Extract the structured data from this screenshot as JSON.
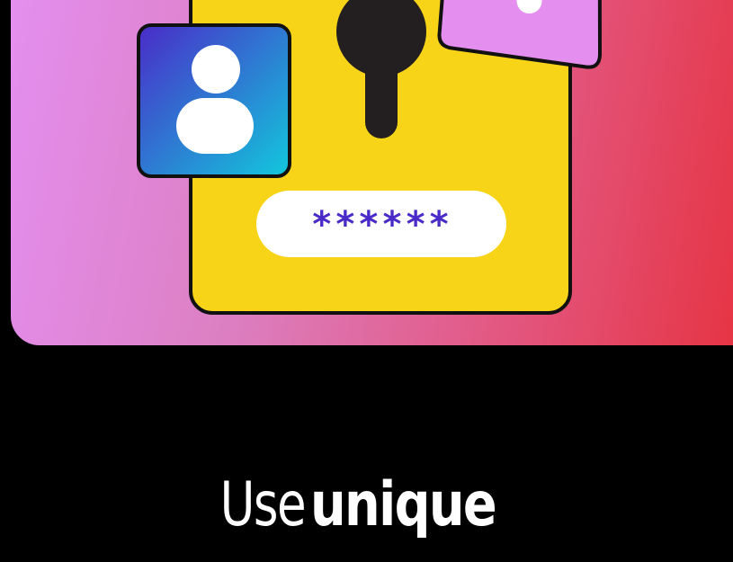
{
  "illustration": {
    "password_mask": "******",
    "icons": [
      "lock-icon",
      "keyhole-icon",
      "user-avatar-icon",
      "tag-icon"
    ],
    "colors": {
      "background": "#000000",
      "gradient_start": "#e48ff0",
      "gradient_end": "#e6303c",
      "lock_body": "#f7d417",
      "avatar_start": "#4a2bc8",
      "avatar_end": "#12c8dc",
      "tag": "#e48ff0",
      "password_text": "#4a2bc8"
    }
  },
  "headline": {
    "light": "Use",
    "bold": "unique"
  }
}
